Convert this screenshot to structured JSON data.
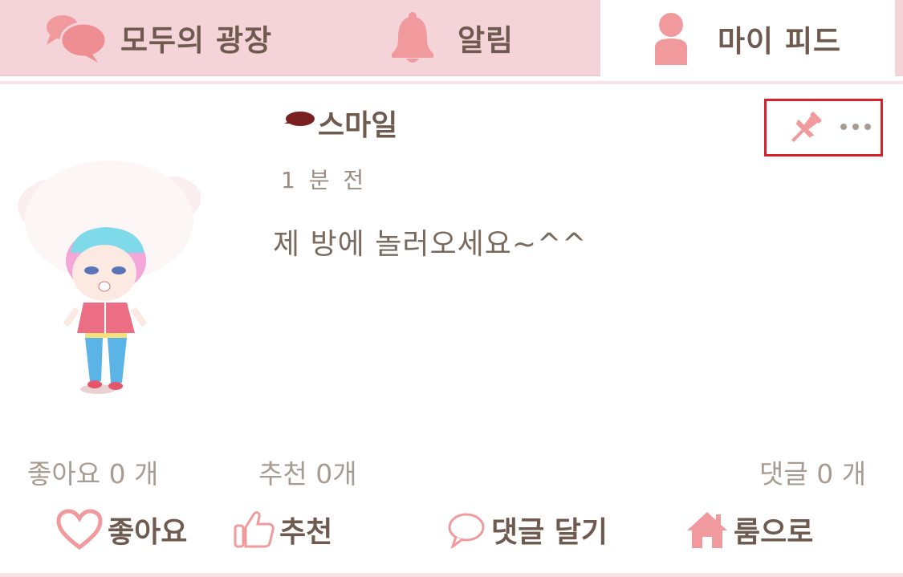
{
  "tabs": [
    {
      "label": "모두의 광장",
      "icon": "speech-bubbles-icon",
      "selected": false
    },
    {
      "label": "알림",
      "icon": "bell-icon",
      "selected": false
    },
    {
      "label": "마이 피드",
      "icon": "person-icon",
      "selected": true
    }
  ],
  "post": {
    "username": "스마일",
    "timestamp": "1 분 전",
    "text": "제 방에 놀러오세요~^^",
    "actions": {
      "pin_icon": "pushpin-icon",
      "more_icon": "more-dots-icon"
    }
  },
  "stats": {
    "likes": "좋아요 0 개",
    "recommends": "추천 0개",
    "comments": "댓글 0 개"
  },
  "buttons": {
    "like": "좋아요",
    "recommend": "추천",
    "comment": "댓글 달기",
    "room": "룸으로"
  },
  "colors": {
    "accent": "#f09a9e",
    "tab_bar": "#f4d4d8",
    "text": "#6e5a4e",
    "muted": "#a89c92",
    "highlight_box": "#d81f2a"
  }
}
